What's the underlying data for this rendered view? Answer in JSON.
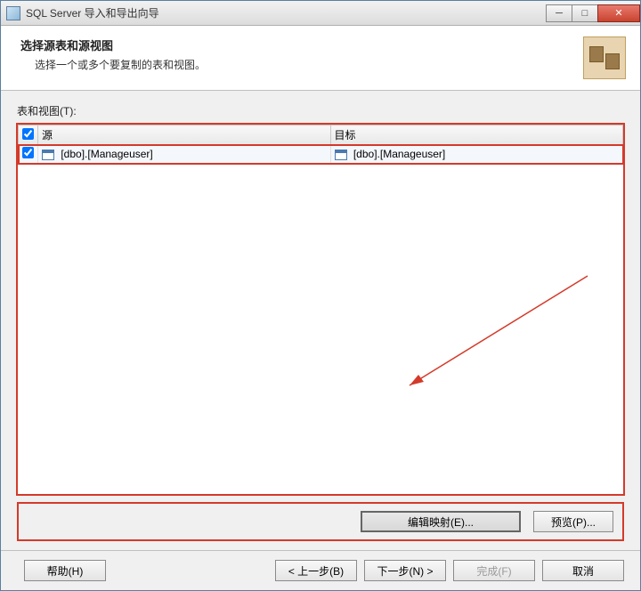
{
  "window": {
    "title": "SQL Server 导入和导出向导"
  },
  "header": {
    "title": "选择源表和源视图",
    "subtitle": "选择一个或多个要复制的表和视图。"
  },
  "section": {
    "tables_label": "表和视图(T):"
  },
  "table": {
    "columns": {
      "source": "源",
      "target": "目标"
    },
    "rows": [
      {
        "checked": true,
        "source": "[dbo].[Manageuser]",
        "target": "[dbo].[Manageuser]"
      }
    ]
  },
  "actions": {
    "edit_mapping": "编辑映射(E)...",
    "preview": "预览(P)..."
  },
  "footer": {
    "help": "帮助(H)",
    "back": "< 上一步(B)",
    "next": "下一步(N) >",
    "finish": "完成(F)",
    "cancel": "取消"
  }
}
